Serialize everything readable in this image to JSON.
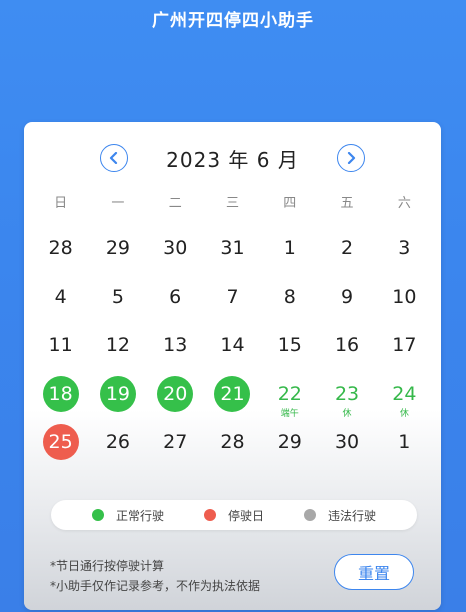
{
  "app": {
    "title": "广州开四停四小助手"
  },
  "calendar": {
    "month_label": "2023 年 6 月",
    "weekdays": [
      "日",
      "一",
      "二",
      "三",
      "四",
      "五",
      "六"
    ],
    "days": [
      {
        "n": "28",
        "s": "other"
      },
      {
        "n": "29",
        "s": "other"
      },
      {
        "n": "30",
        "s": "other"
      },
      {
        "n": "31",
        "s": "other"
      },
      {
        "n": "1",
        "s": "plain"
      },
      {
        "n": "2",
        "s": "plain"
      },
      {
        "n": "3",
        "s": "plain"
      },
      {
        "n": "4",
        "s": "plain"
      },
      {
        "n": "5",
        "s": "plain"
      },
      {
        "n": "6",
        "s": "plain"
      },
      {
        "n": "7",
        "s": "plain"
      },
      {
        "n": "8",
        "s": "plain"
      },
      {
        "n": "9",
        "s": "plain"
      },
      {
        "n": "10",
        "s": "plain"
      },
      {
        "n": "11",
        "s": "plain"
      },
      {
        "n": "12",
        "s": "plain"
      },
      {
        "n": "13",
        "s": "plain"
      },
      {
        "n": "14",
        "s": "plain"
      },
      {
        "n": "15",
        "s": "plain"
      },
      {
        "n": "16",
        "s": "plain"
      },
      {
        "n": "17",
        "s": "plain"
      },
      {
        "n": "18",
        "s": "normal"
      },
      {
        "n": "19",
        "s": "normal"
      },
      {
        "n": "20",
        "s": "normal"
      },
      {
        "n": "21",
        "s": "normal"
      },
      {
        "n": "22",
        "s": "holiday",
        "note": "端午"
      },
      {
        "n": "23",
        "s": "holiday",
        "note": "休"
      },
      {
        "n": "24",
        "s": "holiday",
        "note": "休"
      },
      {
        "n": "25",
        "s": "restricted"
      },
      {
        "n": "26",
        "s": "plain"
      },
      {
        "n": "27",
        "s": "plain"
      },
      {
        "n": "28",
        "s": "plain"
      },
      {
        "n": "29",
        "s": "plain"
      },
      {
        "n": "30",
        "s": "plain"
      },
      {
        "n": "1",
        "s": "other"
      }
    ]
  },
  "legend": [
    {
      "label": "正常行驶",
      "color": "#35c04a"
    },
    {
      "label": "停驶日",
      "color": "#ee5d4e"
    },
    {
      "label": "违法行驶",
      "color": "#a8a8a8"
    }
  ],
  "notes": {
    "line1": "*节日通行按停驶计算",
    "line2": "*小助手仅作记录参考，不作为执法依据"
  },
  "actions": {
    "reset_label": "重置"
  },
  "icons": {
    "prev": "chevron-left-icon",
    "next": "chevron-right-icon"
  },
  "colors": {
    "accent": "#3d86ee",
    "normal": "#35c04a",
    "restricted": "#ee5d4e",
    "illegal": "#a8a8a8"
  }
}
